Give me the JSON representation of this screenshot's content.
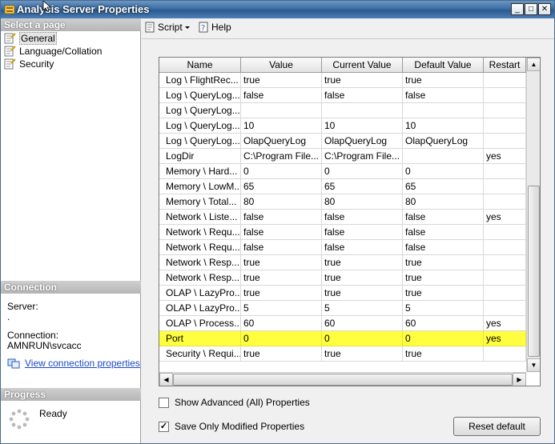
{
  "window": {
    "title": "Analysis Server Properties"
  },
  "titlebar_buttons": {
    "minimize": "_",
    "maximize": "□",
    "close": "✕"
  },
  "left": {
    "select_page_header": "Select a page",
    "pages": [
      {
        "label": "General",
        "selected": true
      },
      {
        "label": "Language/Collation",
        "selected": false
      },
      {
        "label": "Security",
        "selected": false
      }
    ],
    "connection_header": "Connection",
    "server_label": "Server:",
    "server_value": ".",
    "connection_label": "Connection:",
    "connection_value": "AMNRUN\\svcacc",
    "view_connection_link": "View connection properties",
    "progress_header": "Progress",
    "progress_status": "Ready"
  },
  "toolbar": {
    "script_label": "Script",
    "help_label": "Help"
  },
  "grid": {
    "columns": [
      "Name",
      "Value",
      "Current Value",
      "Default Value",
      "Restart"
    ],
    "rows": [
      [
        "Log \\ FlightRec...",
        "true",
        "true",
        "true",
        ""
      ],
      [
        "Log \\ QueryLog...",
        "false",
        "false",
        "false",
        ""
      ],
      [
        "Log \\ QueryLog...",
        "",
        "",
        "",
        ""
      ],
      [
        "Log \\ QueryLog...",
        "10",
        "10",
        "10",
        ""
      ],
      [
        "Log \\ QueryLog...",
        "OlapQueryLog",
        "OlapQueryLog",
        "OlapQueryLog",
        ""
      ],
      [
        "LogDir",
        "C:\\Program File...",
        "C:\\Program File...",
        "",
        "yes"
      ],
      [
        "Memory \\ Hard...",
        "0",
        "0",
        "0",
        ""
      ],
      [
        "Memory \\ LowM...",
        "65",
        "65",
        "65",
        ""
      ],
      [
        "Memory \\ Total...",
        "80",
        "80",
        "80",
        ""
      ],
      [
        "Network \\ Liste...",
        "false",
        "false",
        "false",
        "yes"
      ],
      [
        "Network \\ Requ...",
        "false",
        "false",
        "false",
        ""
      ],
      [
        "Network \\ Requ...",
        "false",
        "false",
        "false",
        ""
      ],
      [
        "Network \\ Resp...",
        "true",
        "true",
        "true",
        ""
      ],
      [
        "Network \\ Resp...",
        "true",
        "true",
        "true",
        ""
      ],
      [
        "OLAP \\ LazyPro...",
        "true",
        "true",
        "true",
        ""
      ],
      [
        "OLAP \\ LazyPro...",
        "5",
        "5",
        "5",
        ""
      ],
      [
        "OLAP \\ Process...",
        "60",
        "60",
        "60",
        "yes"
      ],
      [
        "Port",
        "0",
        "0",
        "0",
        "yes"
      ],
      [
        "Security \\ Requi...",
        "true",
        "true",
        "true",
        ""
      ]
    ],
    "highlighted_row_index": 17,
    "highlight_color": "#ffff3f"
  },
  "options": {
    "show_advanced_label": "Show Advanced (All) Properties",
    "show_advanced_checked": false,
    "save_modified_label": "Save Only Modified Properties",
    "save_modified_checked": true,
    "reset_default_label": "Reset default"
  }
}
